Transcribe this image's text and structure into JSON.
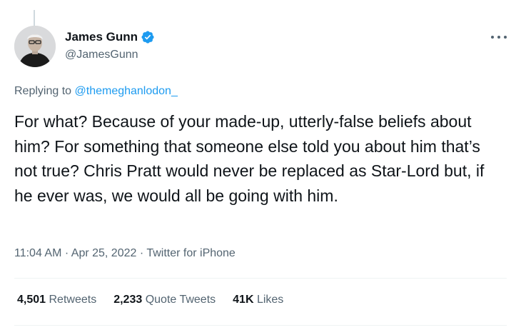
{
  "author": {
    "display_name": "James Gunn",
    "handle": "@JamesGunn",
    "verified": true
  },
  "reply_context": {
    "prefix": "Replying to ",
    "target_handle": "@themeghanlodon_"
  },
  "tweet": {
    "text": "For what? Because of your made-up, utterly-false beliefs about him? For something that someone else told you about him that’s not true? Chris Pratt would never be replaced as Star-Lord but, if he ever was, we would all be going with him.",
    "time": "11:04 AM",
    "date": "Apr 25, 2022",
    "separator": " · ",
    "source": "Twitter for iPhone"
  },
  "stats": {
    "retweets": {
      "count": "4,501",
      "label": "Retweets"
    },
    "quote_tweets": {
      "count": "2,233",
      "label": "Quote Tweets"
    },
    "likes": {
      "count": "41K",
      "label": "Likes"
    }
  },
  "colors": {
    "text": "#0f1419",
    "secondary": "#536471",
    "link": "#1d9bf0",
    "verified": "#1d9bf0",
    "divider": "#eff3f4"
  },
  "icons": {
    "verified": "verified-badge-icon",
    "more": "more-options-icon"
  }
}
